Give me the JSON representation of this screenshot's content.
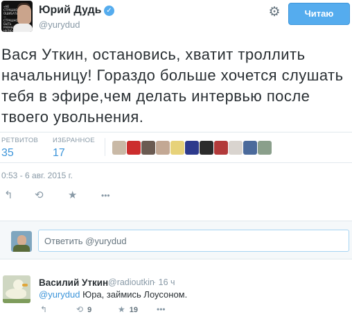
{
  "tweet": {
    "author_name": "Юрий Дудь",
    "author_handle": "@yurydud",
    "avatar_text": "«НЕ СТРАШНО ОШИБАТЬСЯ — СТРАШНО БЫТЬ РАВНЫМ НУЛЮ»",
    "follow_label": "Читаю",
    "text": "Вася Уткин, остановись, хватит троллить начальницу! Гораздо больше хочется слушать тебя в эфире,чем делать интервью после твоего увольнения.",
    "retweets_label": "РЕТВИТОВ",
    "retweets_count": "35",
    "favorites_label": "ИЗБРАННОЕ",
    "favorites_count": "17",
    "timestamp": "0:53 - 6 авг. 2015 г.",
    "actions": {
      "reply": "↰",
      "retweet": "⟲",
      "favorite": "★",
      "more": "•••"
    }
  },
  "favoriters": [
    {
      "color": "#c9b9a6"
    },
    {
      "color": "#cc2d2d"
    },
    {
      "color": "#6b5b52"
    },
    {
      "color": "#c3a894"
    },
    {
      "color": "#e7d27a"
    },
    {
      "color": "#2d3a8c"
    },
    {
      "color": "#2b2b2b"
    },
    {
      "color": "#b23a3a"
    },
    {
      "color": "#d9d4cf"
    },
    {
      "color": "#4b6a9b"
    },
    {
      "color": "#8a9f8b"
    }
  ],
  "reply_box": {
    "placeholder": "Ответить @yurydud"
  },
  "reply_tweet": {
    "author_name": "Василий Уткин",
    "author_handle": "@radioutkin",
    "time": "· 16 ч",
    "mention": "@yurydud",
    "text": " Юра, займись Лоусоном.",
    "retweets_count": "9",
    "favorites_count": "19"
  }
}
